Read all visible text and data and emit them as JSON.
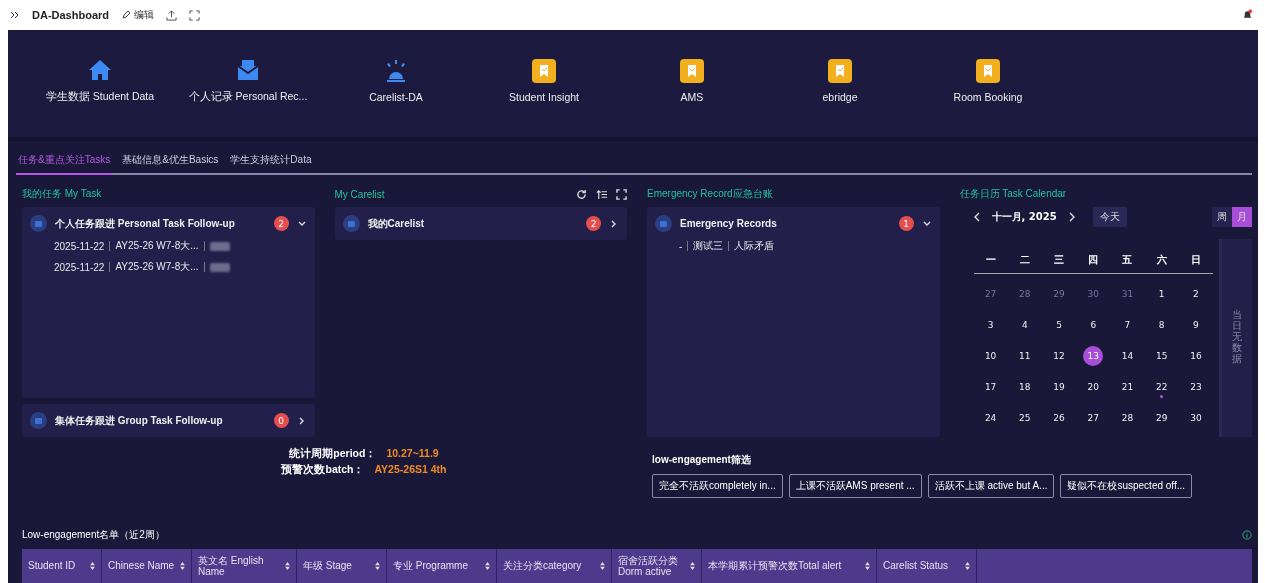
{
  "toolbar": {
    "title": "DA-Dashboard",
    "edit_label": "编辑"
  },
  "launcher": [
    {
      "label": "学生数据 Student Data",
      "kind": "home"
    },
    {
      "label": "个人记录 Personal Rec...",
      "kind": "inbox"
    },
    {
      "label": "Carelist-DA",
      "kind": "alarm"
    },
    {
      "label": "Student Insight",
      "kind": "app"
    },
    {
      "label": "AMS",
      "kind": "app"
    },
    {
      "label": "ebridge",
      "kind": "app"
    },
    {
      "label": "Room Booking",
      "kind": "app"
    }
  ],
  "tabs": [
    {
      "label": "任务&重点关注Tasks",
      "selected": true
    },
    {
      "label": "基础信息&优生Basics",
      "selected": false
    },
    {
      "label": "学生支持统计Data",
      "selected": false
    }
  ],
  "my_task": {
    "title": "我的任务 My Task",
    "groups": [
      {
        "title": "个人任务跟进 Personal Task Follow-up",
        "count": "2",
        "expanded": true,
        "rows": [
          {
            "date": "2025-11-22",
            "task": "AY25-26 W7-8大..."
          },
          {
            "date": "2025-11-22",
            "task": "AY25-26 W7-8大..."
          }
        ]
      },
      {
        "title": "集体任务跟进 Group Task Follow-up",
        "count": "0",
        "expanded": false
      }
    ]
  },
  "my_carelist": {
    "title": "My Carelist",
    "item": {
      "title": "我的Carelist",
      "count": "2"
    }
  },
  "emergency": {
    "title": "Emergency Record应急台账",
    "item": {
      "title": "Emergency Records",
      "count": "1",
      "expanded": true,
      "row": [
        "-",
        "测试三",
        "人际矛盾"
      ]
    }
  },
  "calendar": {
    "title": "任务日历 Task Calendar",
    "month": "十一月, 2025",
    "today_label": "今天",
    "views": [
      {
        "label": "周",
        "selected": false
      },
      {
        "label": "月",
        "selected": true
      }
    ],
    "weekdays": [
      "一",
      "二",
      "三",
      "四",
      "五",
      "六",
      "日"
    ],
    "weeks": [
      [
        {
          "d": "27",
          "muted": true,
          "selected": false,
          "event": false
        },
        {
          "d": "28",
          "muted": true,
          "selected": false,
          "event": false
        },
        {
          "d": "29",
          "muted": true,
          "selected": false,
          "event": false
        },
        {
          "d": "30",
          "muted": true,
          "selected": false,
          "event": false
        },
        {
          "d": "31",
          "muted": true,
          "selected": false,
          "event": false
        },
        {
          "d": "1",
          "muted": false,
          "selected": false,
          "event": false
        },
        {
          "d": "2",
          "muted": false,
          "selected": false,
          "event": false
        }
      ],
      [
        {
          "d": "3",
          "muted": false,
          "selected": false,
          "event": false
        },
        {
          "d": "4",
          "muted": false,
          "selected": false,
          "event": false
        },
        {
          "d": "5",
          "muted": false,
          "selected": false,
          "event": false
        },
        {
          "d": "6",
          "muted": false,
          "selected": false,
          "event": false
        },
        {
          "d": "7",
          "muted": false,
          "selected": false,
          "event": false
        },
        {
          "d": "8",
          "muted": false,
          "selected": false,
          "event": false
        },
        {
          "d": "9",
          "muted": false,
          "selected": false,
          "event": false
        }
      ],
      [
        {
          "d": "10",
          "muted": false,
          "selected": false,
          "event": false
        },
        {
          "d": "11",
          "muted": false,
          "selected": false,
          "event": false
        },
        {
          "d": "12",
          "muted": false,
          "selected": false,
          "event": false
        },
        {
          "d": "13",
          "muted": false,
          "selected": true,
          "event": false
        },
        {
          "d": "14",
          "muted": false,
          "selected": false,
          "event": false
        },
        {
          "d": "15",
          "muted": false,
          "selected": false,
          "event": false
        },
        {
          "d": "16",
          "muted": false,
          "selected": false,
          "event": false
        }
      ],
      [
        {
          "d": "17",
          "muted": false,
          "selected": false,
          "event": false
        },
        {
          "d": "18",
          "muted": false,
          "selected": false,
          "event": false
        },
        {
          "d": "19",
          "muted": false,
          "selected": false,
          "event": false
        },
        {
          "d": "20",
          "muted": false,
          "selected": false,
          "event": false
        },
        {
          "d": "21",
          "muted": false,
          "selected": false,
          "event": false
        },
        {
          "d": "22",
          "muted": false,
          "selected": false,
          "event": true
        },
        {
          "d": "23",
          "muted": false,
          "selected": false,
          "event": false
        }
      ],
      [
        {
          "d": "24",
          "muted": false,
          "selected": false,
          "event": false
        },
        {
          "d": "25",
          "muted": false,
          "selected": false,
          "event": false
        },
        {
          "d": "26",
          "muted": false,
          "selected": false,
          "event": false
        },
        {
          "d": "27",
          "muted": false,
          "selected": false,
          "event": false
        },
        {
          "d": "28",
          "muted": false,
          "selected": false,
          "event": false
        },
        {
          "d": "29",
          "muted": false,
          "selected": false,
          "event": false
        },
        {
          "d": "30",
          "muted": false,
          "selected": false,
          "event": false
        }
      ]
    ],
    "empty_text": "当日无数据"
  },
  "stats": [
    {
      "label": "统计周期period：",
      "value": "10.27~11.9"
    },
    {
      "label": "预警次数batch：",
      "value": "AY25-26S1 4th"
    }
  ],
  "filter": {
    "title": "low-engagement筛选",
    "chips": [
      "完全不活跃completely in...",
      "上课不活跃AMS present ...",
      "活跃不上课 active but A...",
      "疑似不在校suspected off..."
    ]
  },
  "table": {
    "title": "Low-engagement名单（近2周）",
    "columns": [
      "Student ID",
      "Chinese Name",
      "英文名 English Name",
      "年级 Stage",
      "专业 Programme",
      "关注分类category",
      "宿舍活跃分类 Dorm active",
      "本学期累计预警次数Total alert",
      "Carelist Status"
    ]
  }
}
